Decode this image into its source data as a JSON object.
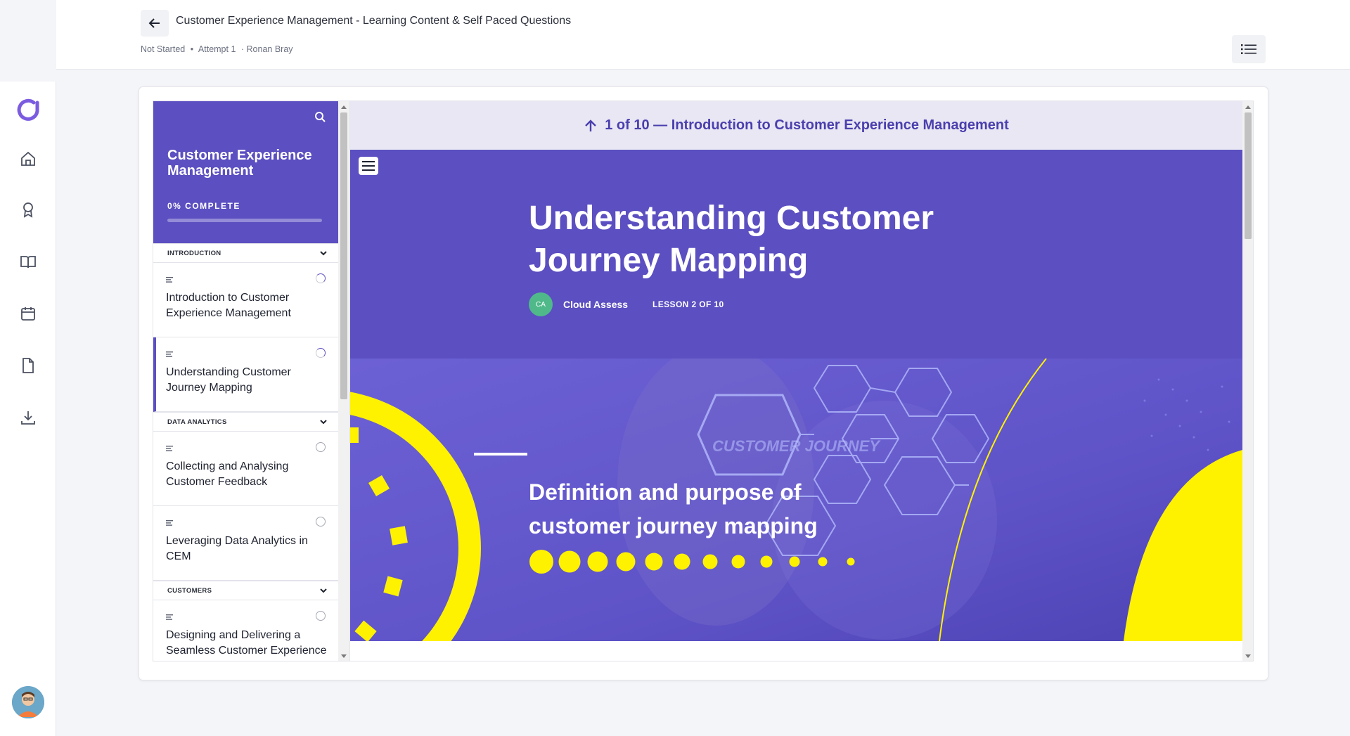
{
  "header": {
    "title": "Customer Experience Management - Learning Content & Self Paced Questions",
    "status": "Not Started",
    "separator": "•",
    "attempt": "Attempt 1",
    "learner": "· Ronan Bray"
  },
  "course": {
    "title": "Customer Experience Management",
    "progress_label": "0% COMPLETE",
    "progress_value": 0,
    "sections": [
      {
        "label": "INTRODUCTION",
        "lessons": [
          {
            "title": "Introduction to Customer Experience Management",
            "status": "in-progress"
          },
          {
            "title": "Understanding Customer Journey Mapping",
            "status": "in-progress",
            "active": true
          }
        ]
      },
      {
        "label": "DATA ANALYTICS",
        "lessons": [
          {
            "title": "Collecting and Analysing Customer Feedback",
            "status": "not-started"
          },
          {
            "title": "Leveraging Data Analytics in CEM",
            "status": "not-started"
          }
        ]
      },
      {
        "label": "CUSTOMERS",
        "lessons": [
          {
            "title": "Designing and Delivering a Seamless Customer Experience",
            "status": "not-started"
          }
        ]
      }
    ]
  },
  "lesson_view": {
    "previous_label": "1 of 10 — Introduction to Customer Experience Management",
    "title": "Understanding Customer Journey Mapping",
    "author_initials": "CA",
    "author": "Cloud Assess",
    "lesson_number": "LESSON 2 OF 10",
    "banner_heading": "Definition and purpose of customer journey mapping",
    "banner_watermark": "CUSTOMER JOURNEY"
  },
  "colors": {
    "brand": "#5b4fc1",
    "accent_yellow": "#fff200",
    "header_bar": "#e9e7f4"
  },
  "icons": [
    "back-arrow-icon",
    "list-menu-icon",
    "logo-icon",
    "home-icon",
    "award-icon",
    "book-icon",
    "calendar-icon",
    "document-icon",
    "download-icon",
    "search-icon",
    "chevron-down-icon",
    "lesson-text-icon",
    "arrow-up-icon",
    "hamburger-icon"
  ]
}
